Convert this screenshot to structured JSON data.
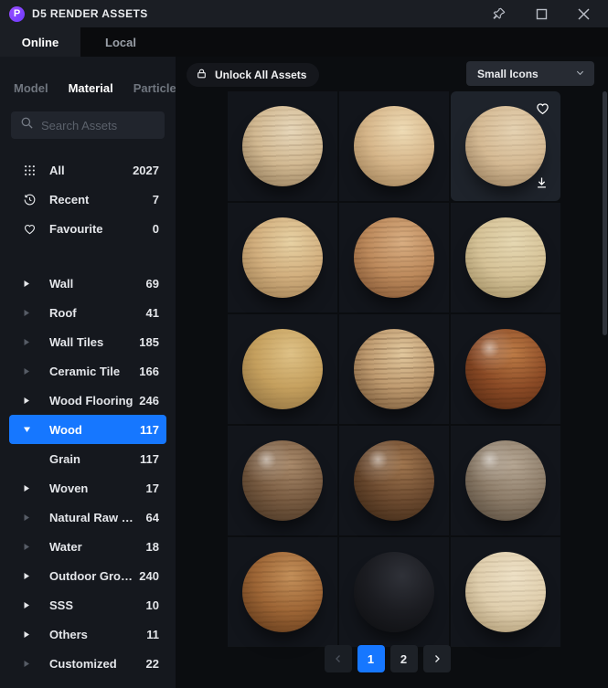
{
  "window": {
    "logo_glyph": "P",
    "title": "D5 RENDER ASSETS"
  },
  "top_tabs": [
    {
      "label": "Online",
      "active": true
    },
    {
      "label": "Local",
      "active": false
    }
  ],
  "sidebar": {
    "tabs": [
      {
        "label": "Model",
        "active": false
      },
      {
        "label": "Material",
        "active": true
      },
      {
        "label": "Particle",
        "active": false
      }
    ],
    "search": {
      "placeholder": "Search Assets"
    },
    "quick": [
      {
        "label": "All",
        "count": "2027",
        "icon": "grid"
      },
      {
        "label": "Recent",
        "count": "7",
        "icon": "clock"
      },
      {
        "label": "Favourite",
        "count": "0",
        "icon": "heart"
      }
    ],
    "categories": [
      {
        "label": "Wall",
        "count": "69",
        "arrow": "right",
        "bright": true
      },
      {
        "label": "Roof",
        "count": "41",
        "arrow": "right",
        "bright": false
      },
      {
        "label": "Wall Tiles",
        "count": "185",
        "arrow": "right",
        "bright": false
      },
      {
        "label": "Ceramic Tile",
        "count": "166",
        "arrow": "right",
        "bright": false
      },
      {
        "label": "Wood Flooring",
        "count": "246",
        "arrow": "right",
        "bright": true
      },
      {
        "label": "Wood",
        "count": "117",
        "arrow": "down",
        "bright": true,
        "selected": true
      },
      {
        "label": "Grain",
        "count": "117",
        "child": true
      },
      {
        "label": "Woven",
        "count": "17",
        "arrow": "right",
        "bright": true
      },
      {
        "label": "Natural Raw Ma...",
        "count": "64",
        "arrow": "right",
        "bright": false
      },
      {
        "label": "Water",
        "count": "18",
        "arrow": "right",
        "bright": false
      },
      {
        "label": "Outdoor Ground",
        "count": "240",
        "arrow": "right",
        "bright": true
      },
      {
        "label": "SSS",
        "count": "10",
        "arrow": "right",
        "bright": true
      },
      {
        "label": "Others",
        "count": "11",
        "arrow": "right",
        "bright": true
      },
      {
        "label": "Customized",
        "count": "22",
        "arrow": "right",
        "bright": false
      }
    ]
  },
  "toolbar": {
    "unlock_label": "Unlock All Assets",
    "view_select_value": "Small Icons"
  },
  "grid": {
    "tiles": [
      {
        "name": "light-striped-oak",
        "base": "#d2b992",
        "light": "#e7d7ba",
        "dark": "#7d6748",
        "stripes": 0.22,
        "specular": false,
        "hovered": false
      },
      {
        "name": "warm-tan-wood",
        "base": "#d6b68a",
        "light": "#efdcb6",
        "dark": "#8d6f48",
        "stripes": 0.1,
        "specular": false,
        "hovered": false
      },
      {
        "name": "beige-wood",
        "base": "#d5ba94",
        "light": "#e5d2b2",
        "dark": "#82694a",
        "stripes": 0.14,
        "specular": false,
        "hovered": true
      },
      {
        "name": "banded-tan-wood",
        "base": "#d2af7e",
        "light": "#e8d2a4",
        "dark": "#8f7046",
        "stripes": 0.2,
        "specular": false,
        "hovered": false
      },
      {
        "name": "rustic-red-wood",
        "base": "#bd8a5c",
        "light": "#d9ae82",
        "dark": "#6e4426",
        "stripes": 0.28,
        "specular": false,
        "hovered": false
      },
      {
        "name": "pale-yellow-wood",
        "base": "#d6c398",
        "light": "#e6d8b2",
        "dark": "#8f7d52",
        "stripes": 0.18,
        "specular": false,
        "hovered": false
      },
      {
        "name": "golden-honey-wood",
        "base": "#c5a05e",
        "light": "#dfc287",
        "dark": "#7d6136",
        "stripes": 0.08,
        "specular": false,
        "hovered": false
      },
      {
        "name": "two-tone-striped-wood",
        "base": "#bf9b70",
        "light": "#e2c89e",
        "dark": "#5f4226",
        "stripes": 0.38,
        "specular": false,
        "hovered": false
      },
      {
        "name": "mahogany-wood",
        "base": "#8c4b26",
        "light": "#bd7b46",
        "dark": "#461f0c",
        "stripes": 0.32,
        "specular": true,
        "hovered": false
      },
      {
        "name": "walnut-wood",
        "base": "#7a5d43",
        "light": "#a98a6b",
        "dark": "#3a2a1b",
        "stripes": 0.3,
        "specular": true,
        "hovered": false
      },
      {
        "name": "dark-walnut-glossy",
        "base": "#6e4c31",
        "light": "#a0764f",
        "dark": "#2e1d0e",
        "stripes": 0.34,
        "specular": true,
        "hovered": false
      },
      {
        "name": "driftwood-gray",
        "base": "#8d7d6a",
        "light": "#b5a693",
        "dark": "#463c30",
        "stripes": 0.2,
        "specular": true,
        "hovered": false
      },
      {
        "name": "rustic-orange-wood",
        "base": "#9e6636",
        "light": "#c4905a",
        "dark": "#4e2c12",
        "stripes": 0.24,
        "specular": false,
        "hovered": false
      },
      {
        "name": "charcoal-black",
        "base": "#1b1c21",
        "light": "#2f3138",
        "dark": "#0a0b0d",
        "stripes": 0,
        "specular": false,
        "hovered": false
      },
      {
        "name": "cream-wood",
        "base": "#e0cfae",
        "light": "#eee1c6",
        "dark": "#9c8760",
        "stripes": 0.15,
        "specular": false,
        "hovered": false
      }
    ]
  },
  "pagination": {
    "pages": [
      "1",
      "2"
    ],
    "active": "1",
    "prev_enabled": false,
    "next_enabled": true
  },
  "colors": {
    "accent_blue": "#1677ff",
    "titlebar": "#1b1e24",
    "sidebar_bg": "#15181e",
    "main_bg": "#0b0d10"
  }
}
